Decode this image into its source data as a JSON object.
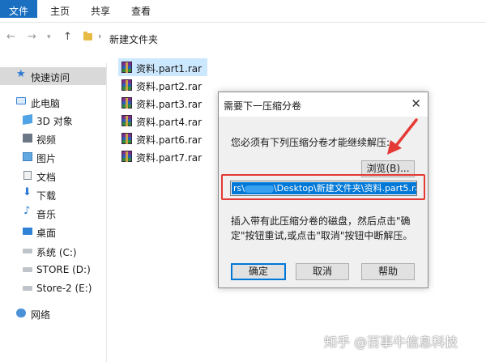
{
  "ribbon": {
    "tabs": [
      "文件",
      "主页",
      "共享",
      "查看"
    ]
  },
  "address": {
    "back_icon": "arrow-left-icon",
    "forward_icon": "arrow-right-icon",
    "recent_icon": "chevron-down-icon",
    "up_icon": "arrow-up-icon",
    "path": "新建文件夹"
  },
  "sidebar": {
    "items": [
      {
        "label": "快速访问",
        "icon": "star-icon"
      },
      {
        "label": "此电脑",
        "icon": "computer-icon"
      },
      {
        "label": "3D 对象",
        "icon": "3d-objects-icon"
      },
      {
        "label": "视频",
        "icon": "video-icon"
      },
      {
        "label": "图片",
        "icon": "pictures-icon"
      },
      {
        "label": "文档",
        "icon": "documents-icon"
      },
      {
        "label": "下载",
        "icon": "download-icon"
      },
      {
        "label": "音乐",
        "icon": "music-icon"
      },
      {
        "label": "桌面",
        "icon": "desktop-icon"
      },
      {
        "label": "系统 (C:)",
        "icon": "drive-icon"
      },
      {
        "label": "STORE (D:)",
        "icon": "drive-icon"
      },
      {
        "label": "Store-2 (E:)",
        "icon": "drive-icon"
      },
      {
        "label": "网络",
        "icon": "network-icon"
      }
    ]
  },
  "files": [
    "资料.part1.rar",
    "资料.part2.rar",
    "资料.part3.rar",
    "资料.part4.rar",
    "资料.part6.rar",
    "资料.part7.rar"
  ],
  "dialog": {
    "title": "需要下一压缩分卷",
    "message": "您必须有下列压缩分卷才能继续解压:",
    "browse_label": "浏览(B)...",
    "path_prefix": "rs\\",
    "path_suffix": "\\Desktop\\新建文件夹\\资料.part5.rar",
    "note": "插入带有此压缩分卷的磁盘，然后点击\"确定\"按钮重试,或点击\"取消\"按钮中断解压。",
    "ok_label": "确定",
    "cancel_label": "取消",
    "help_label": "帮助"
  },
  "watermark": "知乎 @百事牛信息科技",
  "colors": {
    "accent": "#1a6fc0",
    "selection": "#0078d7",
    "highlight": "#e53935"
  }
}
